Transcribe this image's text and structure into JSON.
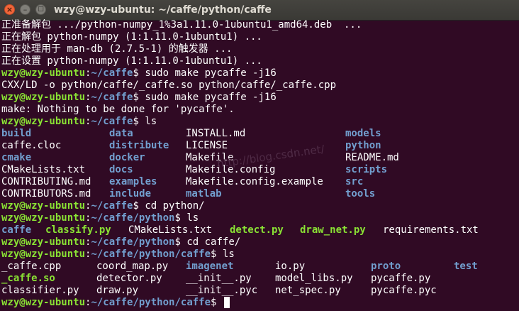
{
  "window": {
    "title": "wzy@wzy-ubuntu: ~/caffe/python/caffe",
    "buttons": {
      "close": "×",
      "minimize": "–",
      "maximize": "□"
    }
  },
  "colors": {
    "background": "#300a24",
    "prompt_user": "#8ae234",
    "prompt_path": "#729fcf",
    "directory": "#729fcf",
    "executable": "#8ae234",
    "text": "#ffffff"
  },
  "terminal": {
    "lines": [
      "正准备解包 .../python-numpy_1%3a1.11.0-1ubuntu1_amd64.deb  ...",
      "正在解包 python-numpy (1:1.11.0-1ubuntu1) ...",
      "正在处理用于 man-db (2.7.5-1) 的触发器 ...",
      "正在设置 python-numpy (1:1.11.0-1ubuntu1) ...",
      "CXX/LD -o python/caffe/_caffe.so python/caffe/_caffe.cpp",
      "make: Nothing to be done for 'pycaffe'."
    ],
    "prompts": [
      {
        "user": "wzy@wzy-ubuntu",
        "sep": ":",
        "path": "~/caffe",
        "symbol": "$ ",
        "command": "sudo make pycaffe -j16"
      },
      {
        "user": "wzy@wzy-ubuntu",
        "sep": ":",
        "path": "~/caffe",
        "symbol": "$ ",
        "command": "sudo make pycaffe -j16"
      },
      {
        "user": "wzy@wzy-ubuntu",
        "sep": ":",
        "path": "~/caffe",
        "symbol": "$ ",
        "command": "ls"
      },
      {
        "user": "wzy@wzy-ubuntu",
        "sep": ":",
        "path": "~/caffe",
        "symbol": "$ ",
        "command": "cd python/"
      },
      {
        "user": "wzy@wzy-ubuntu",
        "sep": ":",
        "path": "~/caffe/python",
        "symbol": "$ ",
        "command": "ls"
      },
      {
        "user": "wzy@wzy-ubuntu",
        "sep": ":",
        "path": "~/caffe/python",
        "symbol": "$ ",
        "command": "cd caffe/"
      },
      {
        "user": "wzy@wzy-ubuntu",
        "sep": ":",
        "path": "~/caffe/python/caffe",
        "symbol": "$ ",
        "command": "ls"
      },
      {
        "user": "wzy@wzy-ubuntu",
        "sep": ":",
        "path": "~/caffe/python/caffe",
        "symbol": "$ ",
        "command": ""
      }
    ],
    "ls_caffe": [
      [
        {
          "name": "build",
          "type": "dir"
        },
        {
          "name": "data",
          "type": "dir"
        },
        {
          "name": "INSTALL.md",
          "type": "file"
        },
        {
          "name": "models",
          "type": "dir"
        }
      ],
      [
        {
          "name": "caffe.cloc",
          "type": "file"
        },
        {
          "name": "distribute",
          "type": "dir"
        },
        {
          "name": "LICENSE",
          "type": "file"
        },
        {
          "name": "python",
          "type": "dir"
        }
      ],
      [
        {
          "name": "cmake",
          "type": "dir"
        },
        {
          "name": "docker",
          "type": "dir"
        },
        {
          "name": "Makefile",
          "type": "file"
        },
        {
          "name": "README.md",
          "type": "file"
        }
      ],
      [
        {
          "name": "CMakeLists.txt",
          "type": "file"
        },
        {
          "name": "docs",
          "type": "dir"
        },
        {
          "name": "Makefile.config",
          "type": "file"
        },
        {
          "name": "scripts",
          "type": "dir"
        }
      ],
      [
        {
          "name": "CONTRIBUTING.md",
          "type": "file"
        },
        {
          "name": "examples",
          "type": "dir"
        },
        {
          "name": "Makefile.config.example",
          "type": "file"
        },
        {
          "name": "src",
          "type": "dir"
        }
      ],
      [
        {
          "name": "CONTRIBUTORS.md",
          "type": "file"
        },
        {
          "name": "include",
          "type": "dir"
        },
        {
          "name": "matlab",
          "type": "dir"
        },
        {
          "name": "tools",
          "type": "dir"
        }
      ]
    ],
    "ls_python": [
      {
        "name": "caffe",
        "type": "dir"
      },
      {
        "name": "classify.py",
        "type": "exec"
      },
      {
        "name": "CMakeLists.txt",
        "type": "file"
      },
      {
        "name": "detect.py",
        "type": "exec"
      },
      {
        "name": "draw_net.py",
        "type": "exec"
      },
      {
        "name": "requirements.txt",
        "type": "file"
      }
    ],
    "ls_python_caffe": [
      [
        {
          "name": "_caffe.cpp",
          "type": "file"
        },
        {
          "name": "coord_map.py",
          "type": "file"
        },
        {
          "name": "imagenet",
          "type": "dir"
        },
        {
          "name": "io.py",
          "type": "file"
        },
        {
          "name": "proto",
          "type": "dir"
        },
        {
          "name": "test",
          "type": "dir"
        }
      ],
      [
        {
          "name": "_caffe.so",
          "type": "exec"
        },
        {
          "name": "detector.py",
          "type": "file"
        },
        {
          "name": "__init__.py",
          "type": "file"
        },
        {
          "name": "model_libs.py",
          "type": "file"
        },
        {
          "name": "pycaffe.py",
          "type": "file"
        }
      ],
      [
        {
          "name": "classifier.py",
          "type": "file"
        },
        {
          "name": "draw.py",
          "type": "file"
        },
        {
          "name": "__init__.pyc",
          "type": "file"
        },
        {
          "name": "net_spec.py",
          "type": "file"
        },
        {
          "name": "pycaffe.pyc",
          "type": "file"
        }
      ]
    ],
    "watermark": "http://blog.csdn.net/"
  }
}
